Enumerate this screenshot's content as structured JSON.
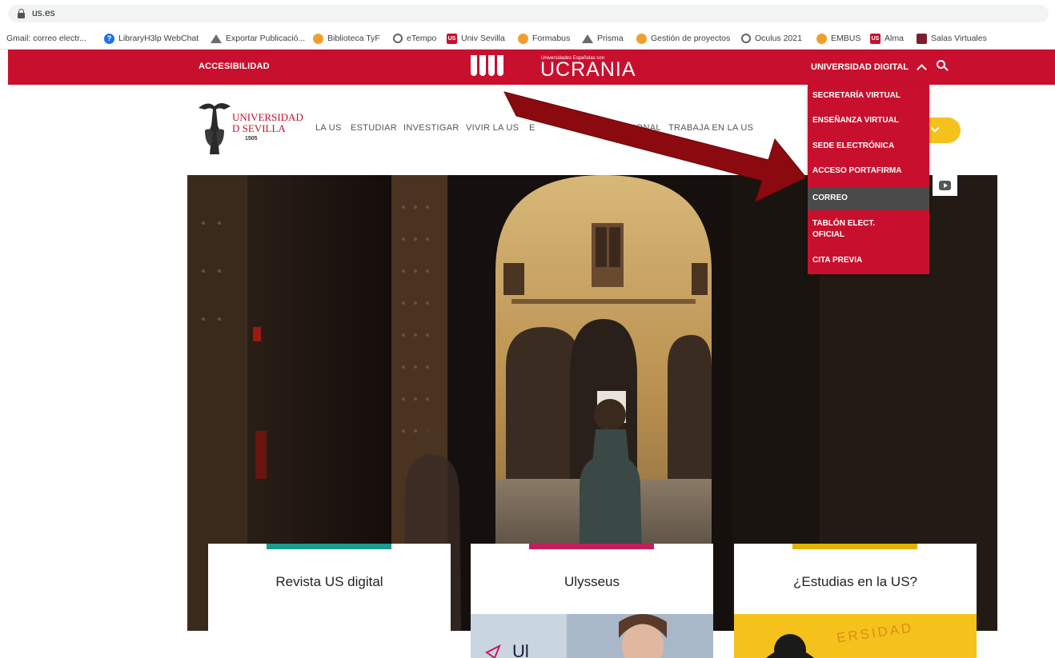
{
  "browser": {
    "url": "us.es",
    "bookmarks": [
      {
        "label": "Gmail: correo electr...",
        "icon": "partial-icon"
      },
      {
        "label": "LibraryH3lp WebChat",
        "icon": "help-icon"
      },
      {
        "label": "Exportar Publicació...",
        "icon": "prisma-icon"
      },
      {
        "label": "Biblioteca TyF",
        "icon": "us-logo-icon"
      },
      {
        "label": "eTempo",
        "icon": "globe-icon"
      },
      {
        "label": "Univ Sevilla",
        "icon": "us-badge-icon"
      },
      {
        "label": "Formabus",
        "icon": "us-logo-icon"
      },
      {
        "label": "Prisma",
        "icon": "prisma-icon"
      },
      {
        "label": "Gestión de proyectos",
        "icon": "us-logo-icon"
      },
      {
        "label": "Oculus 2021",
        "icon": "globe-icon"
      },
      {
        "label": "EMBUS",
        "icon": "embus-icon"
      },
      {
        "label": "Alma",
        "icon": "us-badge-icon"
      },
      {
        "label": "Salas Virtuales",
        "icon": "salas-icon"
      }
    ]
  },
  "header": {
    "accessibility": "ACCESIBILIDAD",
    "ucrania_small": "Universidades Españolas con",
    "ucrania_big": "UCRANIA",
    "digital_menu": "UNIVERSIDAD DIGITAL"
  },
  "logo": {
    "line1": "UNIVERSIDAD",
    "line2": "D SEVILLA",
    "year": "1505"
  },
  "nav": [
    "LA US",
    "ESTUDIAR",
    "INVESTIGAR",
    "VIVIR LA US",
    "E",
    "CIONAL",
    "TRABAJA EN LA US"
  ],
  "dropdown": [
    {
      "label": "SECRETARÍA VIRTUAL",
      "active": false
    },
    {
      "label": "ENSEÑANZA VIRTUAL",
      "active": false
    },
    {
      "label": "SEDE ELECTRÓNICA",
      "active": false
    },
    {
      "label": "ACCESO PORTAFIRMA",
      "active": false
    },
    {
      "label": "CORREO",
      "active": true
    },
    {
      "label": "TABLÓN ELECT.",
      "label2": "OFICIAL",
      "active": false
    },
    {
      "label": "CITA PREVIA",
      "active": false
    }
  ],
  "cards": [
    {
      "title": "Revista US digital",
      "accent": "#1a9c8e"
    },
    {
      "title": "Ulysseus",
      "accent": "#c41e5a"
    },
    {
      "title": "¿Estudias en la US?",
      "accent": "#e0b400"
    }
  ],
  "card_strip_texts": {
    "ulysseus_partial": "Ul",
    "estudias_partial": "ERSIDAD"
  },
  "colors": {
    "brand_red": "#c8102e",
    "dark_arrow": "#8b0a0f",
    "menu_active": "#4a4a4a",
    "accent_yellow": "#f5c21b"
  }
}
